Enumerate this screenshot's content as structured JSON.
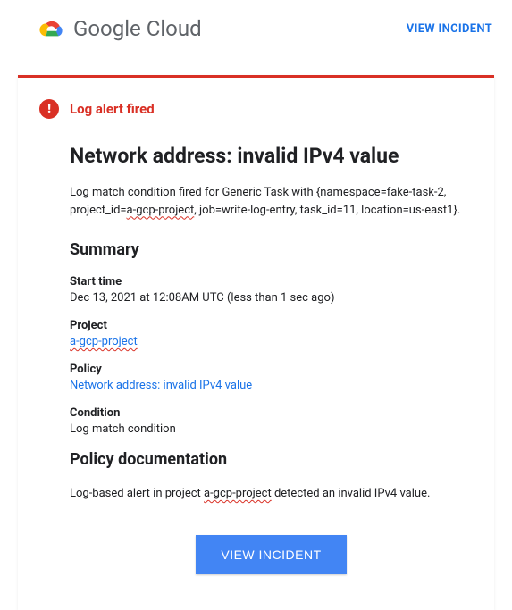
{
  "header": {
    "product_name_strong": "Google",
    "product_name_light": " Cloud",
    "view_incident_label": "VIEW INCIDENT"
  },
  "alert": {
    "badge_text": "Log alert fired",
    "title": "Network address: invalid IPv4 value",
    "description_prefix": "Log match condition fired for Generic Task with {namespace=fake-task-2, project_id=",
    "description_proj": "a-gcp-project",
    "description_suffix": ", job=write-log-entry, task_id=11, location=us-east1}."
  },
  "summary": {
    "heading": "Summary",
    "start_time_label": "Start time",
    "start_time_value": "Dec 13, 2021 at 12:08AM UTC (less than 1 sec ago)",
    "project_label": "Project",
    "project_value": "a-gcp-project",
    "policy_label": "Policy",
    "policy_value": "Network address: invalid IPv4 value",
    "condition_label": "Condition",
    "condition_value": "Log match condition"
  },
  "policy_doc": {
    "heading": "Policy documentation",
    "text_prefix": "Log-based alert in project ",
    "text_proj": "a-gcp-project",
    "text_suffix": " detected an invalid IPv4 value."
  },
  "button": {
    "label": "VIEW INCIDENT"
  }
}
